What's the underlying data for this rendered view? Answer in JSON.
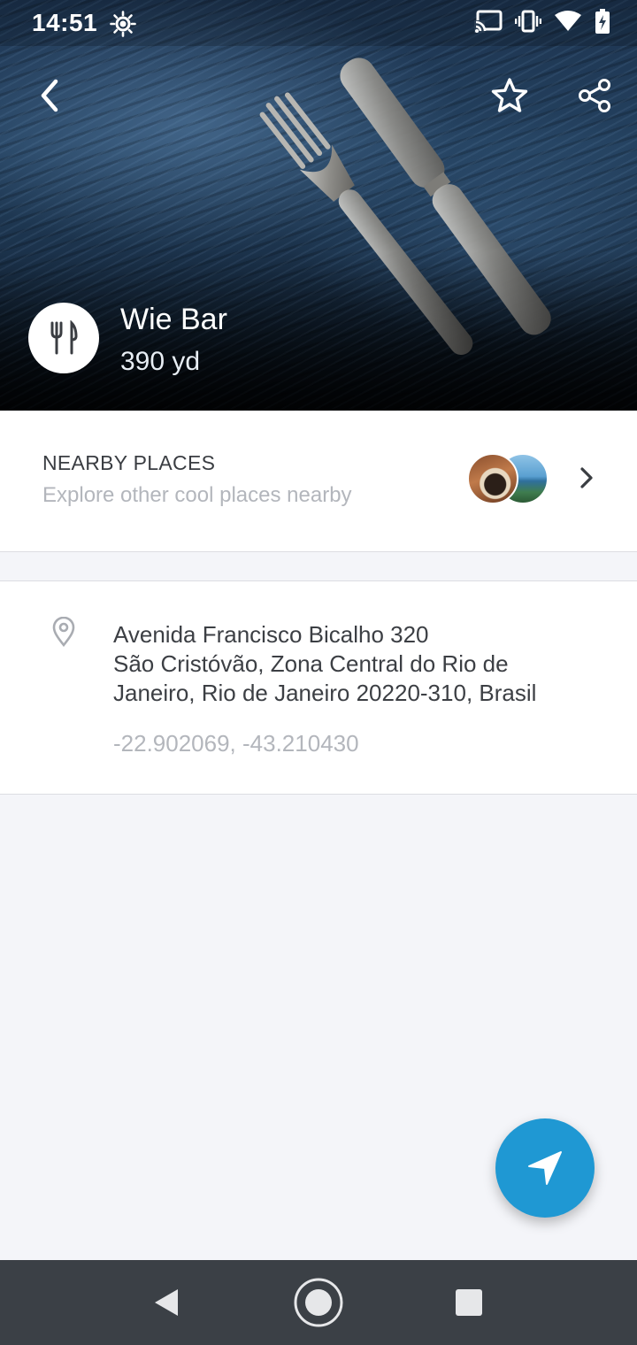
{
  "status_bar": {
    "time": "14:51",
    "icons": [
      "brightness-icon",
      "cast-icon",
      "vibrate-icon",
      "wifi-icon",
      "battery-charging-icon"
    ]
  },
  "header": {
    "back_icon": "arrow-back-icon",
    "favorite_icon": "star-outline-icon",
    "share_icon": "share-icon"
  },
  "place": {
    "category_icon": "fork-knife-icon",
    "name": "Wie Bar",
    "distance": "390 yd"
  },
  "nearby": {
    "title": "NEARBY PLACES",
    "subtitle": "Explore other cool places nearby"
  },
  "address": {
    "line1": "Avenida Francisco Bicalho 320",
    "line2": "São Cristóvão, Zona Central do Rio de",
    "line3": "Janeiro, Rio de Janeiro 20220-310, Brasil",
    "coordinates": "-22.902069, -43.210430"
  },
  "fab": {
    "icon": "navigation-arrow-icon"
  },
  "colors": {
    "accent": "#1f98d3",
    "nav_bar": "#3b4046",
    "background": "#f4f5f9"
  }
}
